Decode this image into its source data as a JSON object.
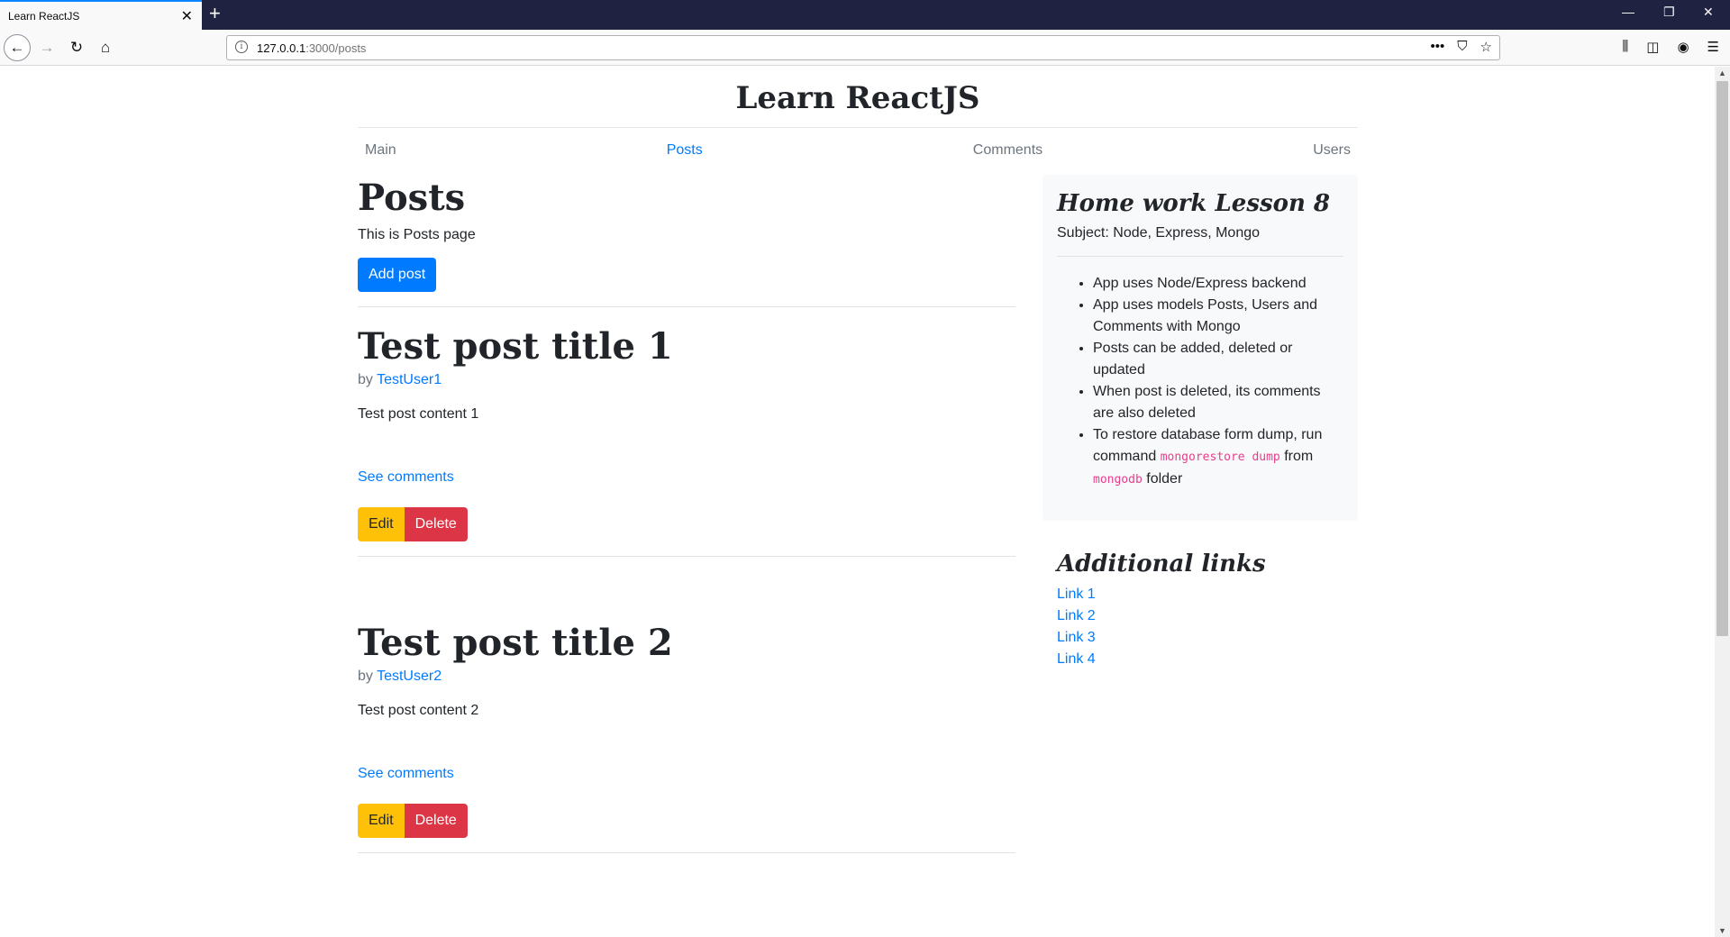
{
  "browser": {
    "tab_title": "Learn ReactJS",
    "url_host": "127.0.0.1",
    "url_path": ":3000/posts"
  },
  "site": {
    "title": "Learn ReactJS",
    "nav": [
      {
        "label": "Main",
        "active": false
      },
      {
        "label": "Posts",
        "active": true
      },
      {
        "label": "Comments",
        "active": false
      },
      {
        "label": "Users",
        "active": false
      }
    ]
  },
  "main": {
    "heading": "Posts",
    "description": "This is Posts page",
    "add_button": "Add post",
    "posts": [
      {
        "title": "Test post title 1",
        "by": "by",
        "author": "TestUser1",
        "content": "Test post content 1",
        "comments_link": "See comments",
        "edit_label": "Edit",
        "delete_label": "Delete"
      },
      {
        "title": "Test post title 2",
        "by": "by",
        "author": "TestUser2",
        "content": "Test post content 2",
        "comments_link": "See comments",
        "edit_label": "Edit",
        "delete_label": "Delete"
      }
    ]
  },
  "sidebar": {
    "heading": "Home work Lesson 8",
    "subject": "Subject: Node, Express, Mongo",
    "items": [
      "App uses Node/Express backend",
      "App uses models Posts, Users and Comments with Mongo",
      "Posts can be added, deleted or updated",
      "When post is deleted, its comments are also deleted"
    ],
    "restore": {
      "part1": "To restore database form dump, run command ",
      "code1": "mongorestore dump",
      "part2": " from ",
      "code2": "mongodb",
      "part3": " folder"
    },
    "links_heading": "Additional links",
    "links": [
      "Link 1",
      "Link 2",
      "Link 3",
      "Link 4"
    ]
  }
}
